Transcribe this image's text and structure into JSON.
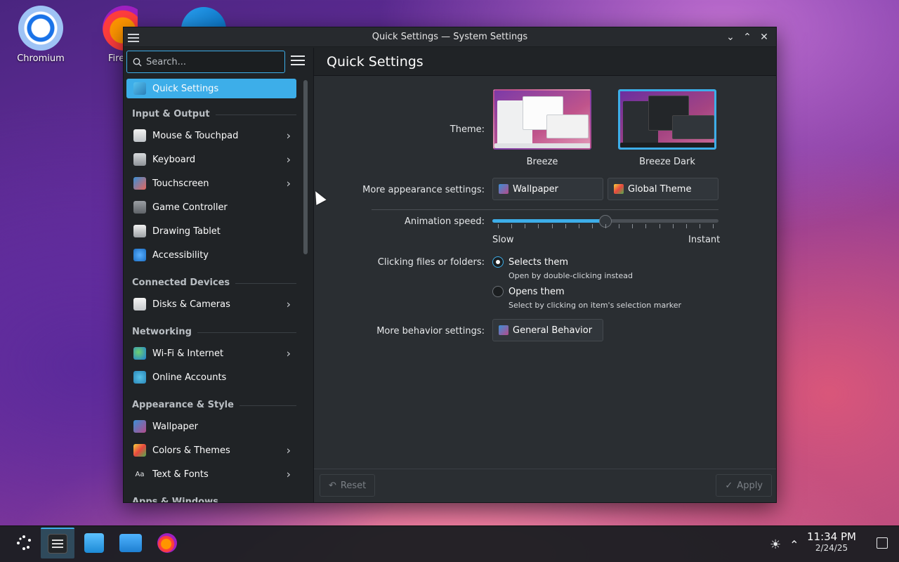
{
  "desktop": {
    "icons": [
      {
        "label": "Chromium"
      },
      {
        "label": "Fire"
      }
    ]
  },
  "window": {
    "title": "Quick Settings — System Settings",
    "controls": {
      "minimize": "⌄",
      "maximize": "⌃",
      "close": "✕"
    }
  },
  "sidebar": {
    "search_placeholder": "Search...",
    "active": {
      "label": "Quick Settings",
      "icon": "quick-settings-icon"
    },
    "sections": [
      {
        "title": "Input & Output",
        "items": [
          {
            "label": "Mouse & Touchpad",
            "icon": "mouse-icon",
            "chevron": true
          },
          {
            "label": "Keyboard",
            "icon": "keyboard-icon",
            "chevron": true
          },
          {
            "label": "Touchscreen",
            "icon": "touchscreen-icon",
            "chevron": true
          },
          {
            "label": "Game Controller",
            "icon": "gamepad-icon",
            "chevron": false
          },
          {
            "label": "Drawing Tablet",
            "icon": "tablet-icon",
            "chevron": false
          },
          {
            "label": "Accessibility",
            "icon": "accessibility-icon",
            "chevron": false
          }
        ]
      },
      {
        "title": "Connected Devices",
        "items": [
          {
            "label": "Disks & Cameras",
            "icon": "disk-icon",
            "chevron": true
          }
        ]
      },
      {
        "title": "Networking",
        "items": [
          {
            "label": "Wi-Fi & Internet",
            "icon": "globe-icon",
            "chevron": true
          },
          {
            "label": "Online Accounts",
            "icon": "online-accounts-icon",
            "chevron": false
          }
        ]
      },
      {
        "title": "Appearance & Style",
        "items": [
          {
            "label": "Wallpaper",
            "icon": "wallpaper-icon",
            "chevron": false
          },
          {
            "label": "Colors & Themes",
            "icon": "colors-icon",
            "chevron": true
          },
          {
            "label": "Text & Fonts",
            "icon": "fonts-icon",
            "chevron": true
          }
        ]
      },
      {
        "title": "Apps & Windows",
        "items": []
      }
    ]
  },
  "main": {
    "title": "Quick Settings",
    "theme_label": "Theme:",
    "themes": [
      {
        "name": "Breeze",
        "selected": false
      },
      {
        "name": "Breeze Dark",
        "selected": true
      }
    ],
    "appearance_label": "More appearance settings:",
    "appearance_buttons": [
      "Wallpaper",
      "Global Theme"
    ],
    "animation_label": "Animation speed:",
    "animation": {
      "min_label": "Slow",
      "max_label": "Instant",
      "value_fraction": 0.5,
      "ticks": 17
    },
    "clicking_label": "Clicking files or folders:",
    "clicking_options": [
      {
        "label": "Selects them",
        "hint": "Open by double-clicking instead",
        "checked": true
      },
      {
        "label": "Opens them",
        "hint": "Select by clicking on item's selection marker",
        "checked": false
      }
    ],
    "behavior_label": "More behavior settings:",
    "behavior_button": "General Behavior",
    "footer": {
      "reset": "Reset",
      "apply": "Apply"
    }
  },
  "taskbar": {
    "time": "11:34 PM",
    "date": "2/24/25"
  },
  "colors": {
    "accent": "#3daee9",
    "window_bg": "#2a2e32",
    "sidebar_bg": "#202326"
  }
}
